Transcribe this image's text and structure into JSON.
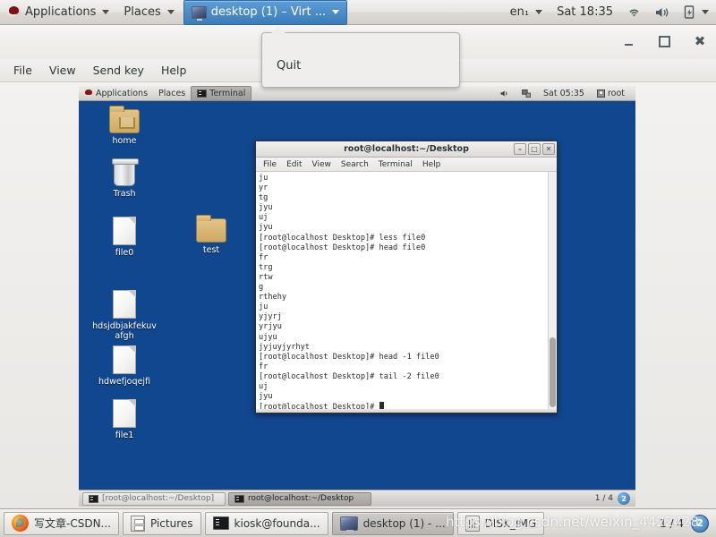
{
  "host_panel": {
    "logo_icon": "fedora-logo-icon",
    "applications_label": "Applications",
    "places_label": "Places",
    "window_button_label": "desktop (1) – Virt ...",
    "window_button_icon": "virt-viewer-monitor-icon",
    "keyboard_layout": "en₁",
    "clock": "Sat 18:35",
    "wifi_icon": "wifi-icon",
    "volume_icon": "volume-icon",
    "power_icon": "battery-icon",
    "menu_caret_icon": "chevron-down-icon"
  },
  "vm_window": {
    "window_controls": {
      "minimize_icon": "minimize-icon",
      "maximize_icon": "maximize-icon",
      "close_icon": "close-icon"
    },
    "menubar": [
      "File",
      "View",
      "Send key",
      "Help"
    ],
    "quit_menu": {
      "items": [
        "Quit"
      ]
    }
  },
  "guest": {
    "panel": {
      "applications_label": "Applications",
      "places_label": "Places",
      "task_label": "Terminal",
      "volume_icon": "volume-icon",
      "network_icon": "network-icon",
      "clock": "Sat 05:35",
      "user_icon": "user-icon",
      "user_label": "root"
    },
    "desktop_icons": [
      {
        "label": "home",
        "icon": "home-folder-icon"
      },
      {
        "label": "Trash",
        "icon": "trash-icon"
      },
      {
        "label": "file0",
        "icon": "document-icon"
      },
      {
        "label": "test",
        "icon": "folder-icon"
      },
      {
        "label": "hdsjdbjakfekuvafgh",
        "icon": "document-icon"
      },
      {
        "label": "hdwefjoqejfi",
        "icon": "document-icon"
      },
      {
        "label": "file1",
        "icon": "document-icon"
      }
    ],
    "terminal": {
      "title": "root@localhost:~/Desktop",
      "menu": [
        "File",
        "Edit",
        "View",
        "Search",
        "Terminal",
        "Help"
      ],
      "window_controls": {
        "minimize_icon": "minimize-icon",
        "maximize_icon": "maximize-icon",
        "close_icon": "close-icon"
      },
      "content": "ju\nyr\ntg\njyu\nuj\njyu\n[root@localhost Desktop]# less file0\n[root@localhost Desktop]# head file0\nfr\ntrg\nrtw\ng\nrthehy\nju\nyjyrj\nyrjyu\nujyu\njyjuyjyrhyt\n[root@localhost Desktop]# head -1 file0\nfr\n[root@localhost Desktop]# tail -2 file0\nuj\njyu\n[root@localhost Desktop]# "
    },
    "taskbar": {
      "buttons": [
        {
          "label": "[root@localhost:~/Desktop]",
          "icon": "terminal-icon",
          "active": false
        },
        {
          "label": "root@localhost:~/Desktop",
          "icon": "terminal-icon",
          "active": true
        }
      ],
      "workspace_counter": "1 / 4",
      "workspace_badge": "2"
    }
  },
  "host_taskbar": {
    "buttons": [
      {
        "label": "写文章-CSDN...",
        "icon": "firefox-icon"
      },
      {
        "label": "Pictures",
        "icon": "file-manager-icon"
      },
      {
        "label": "kiosk@founda...",
        "icon": "terminal-icon"
      },
      {
        "label": "desktop (1) - ...",
        "icon": "virt-viewer-monitor-icon"
      },
      {
        "label": "DISK_IMG",
        "icon": "disk-image-icon"
      }
    ],
    "workspace_counter": "1 / 4",
    "workspace_badge": "2"
  },
  "watermark": "https://blog.csdn.net/weixin_4422428"
}
